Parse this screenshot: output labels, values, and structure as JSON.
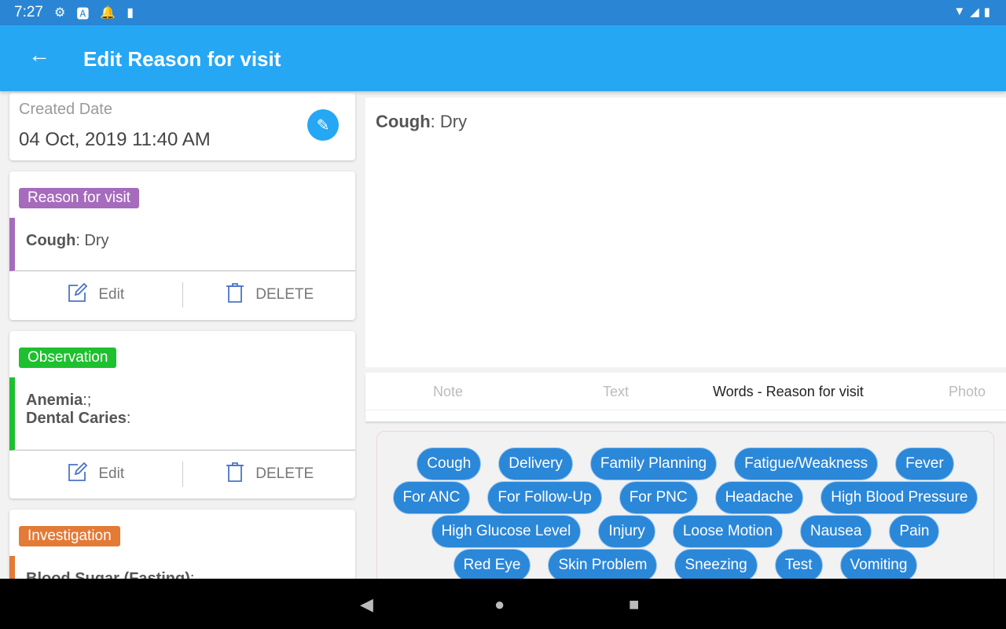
{
  "status_bar": {
    "time": "7:27",
    "icons": [
      "gear-icon",
      "a-icon",
      "alarm-icon",
      "sd-card-icon"
    ],
    "right_icons": [
      "wifi-icon",
      "signal-icon",
      "battery-icon"
    ]
  },
  "app_bar": {
    "title": "Edit Reason for visit",
    "back": "←"
  },
  "created": {
    "label": "Created Date",
    "value": "04 Oct, 2019 11:40 AM"
  },
  "cards": [
    {
      "tag": "Reason for visit",
      "color": "#a66bbd",
      "lines": [
        {
          "key": "Cough",
          "value": ": Dry"
        }
      ],
      "edit": "Edit",
      "delete": "DELETE"
    },
    {
      "tag": "Observation",
      "color": "#1ec02f",
      "lines": [
        {
          "key": "Anemia",
          "value": ":;"
        },
        {
          "key": "Dental Caries",
          "value": ":"
        }
      ],
      "edit": "Edit",
      "delete": "DELETE"
    },
    {
      "tag": "Investigation",
      "color": "#e37a36",
      "lines": [
        {
          "key": "Blood Sugar (Fasting)",
          "value": ":"
        }
      ]
    }
  ],
  "preview": {
    "key": "Cough",
    "value": ": Dry"
  },
  "tabs": [
    "Note",
    "Text",
    "Words - Reason for visit",
    "Photo"
  ],
  "active_tab": 2,
  "words": [
    "Cough",
    "Delivery",
    "Family Planning",
    "Fatigue/Weakness",
    "Fever",
    "For ANC",
    "For Follow-Up",
    "For PNC",
    "Headache",
    "High Blood Pressure",
    "High Glucose Level",
    "Injury",
    "Loose Motion",
    "Nausea",
    "Pain",
    "Red Eye",
    "Skin Problem",
    "Sneezing",
    "Test",
    "Vomiting"
  ],
  "colors": {
    "primary": "#25a7f4",
    "chip": "#2b87d8"
  }
}
